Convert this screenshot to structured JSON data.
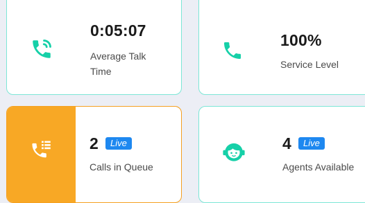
{
  "colors": {
    "accent_teal": "#16d0a8",
    "queue_orange": "#f8a825",
    "live_badge_blue": "#1e88f0"
  },
  "cards": [
    {
      "icon": "phone-calling-icon",
      "value": "0:05:07",
      "label_lines": [
        "Average Talk",
        "Time"
      ]
    },
    {
      "icon": "phone-icon",
      "value": "100%",
      "label": "Service Level"
    },
    {
      "icon": "phone-list-icon",
      "value": "2",
      "badge": "Live",
      "label": "Calls in Queue"
    },
    {
      "icon": "agent-headset-icon",
      "value": "4",
      "badge": "Live",
      "label": "Agents Available"
    }
  ]
}
